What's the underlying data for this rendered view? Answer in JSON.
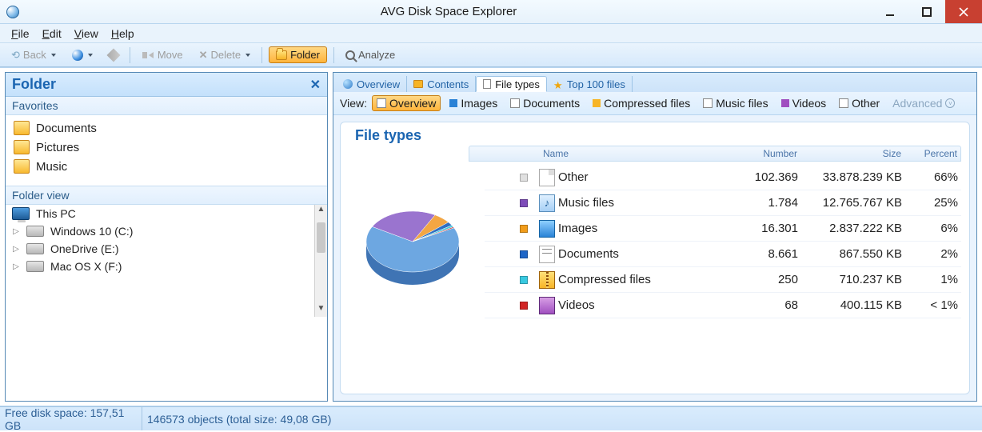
{
  "app": {
    "title": "AVG Disk Space Explorer"
  },
  "menu": {
    "file": "File",
    "edit": "Edit",
    "view": "View",
    "help": "Help"
  },
  "toolbar": {
    "back": "Back",
    "move": "Move",
    "delete": "Delete",
    "folder": "Folder",
    "analyze": "Analyze"
  },
  "sidebar": {
    "title": "Folder",
    "favorites_label": "Favorites",
    "favorites": [
      {
        "label": "Documents"
      },
      {
        "label": "Pictures"
      },
      {
        "label": "Music"
      }
    ],
    "folder_view_label": "Folder view",
    "tree": [
      {
        "label": "This PC",
        "bold": true,
        "icon": "pc"
      },
      {
        "label": "Windows 10 (C:)",
        "icon": "drive"
      },
      {
        "label": "OneDrive (E:)",
        "icon": "drive"
      },
      {
        "label": "Mac OS X (F:)",
        "icon": "drive"
      }
    ]
  },
  "tabs": [
    "Overview",
    "Contents",
    "File types",
    "Top 100 files"
  ],
  "tabs_active_index": 2,
  "viewbar": {
    "label": "View:",
    "items": [
      "Overview",
      "Images",
      "Documents",
      "Compressed files",
      "Music files",
      "Videos",
      "Other"
    ],
    "advanced_label": "Advanced"
  },
  "panel": {
    "title": "File types",
    "columns": {
      "name": "Name",
      "number": "Number",
      "size": "Size",
      "percent": "Percent"
    },
    "rows": [
      {
        "name": "Other",
        "number": "102.369",
        "size": "33.878.239 KB",
        "percent": "66%",
        "color": "#e0e0e0",
        "icon": "doc"
      },
      {
        "name": "Music files",
        "number": "1.784",
        "size": "12.765.767 KB",
        "percent": "25%",
        "color": "#7e4cb9",
        "icon": "music"
      },
      {
        "name": "Images",
        "number": "16.301",
        "size": "2.837.222 KB",
        "percent": "6%",
        "color": "#f19c1a",
        "icon": "img"
      },
      {
        "name": "Documents",
        "number": "8.661",
        "size": "867.550 KB",
        "percent": "2%",
        "color": "#1e66c7",
        "icon": "docs"
      },
      {
        "name": "Compressed files",
        "number": "250",
        "size": "710.237 KB",
        "percent": "1%",
        "color": "#38c9e0",
        "icon": "zip"
      },
      {
        "name": "Videos",
        "number": "68",
        "size": "400.115 KB",
        "percent": "< 1%",
        "color": "#d22424",
        "icon": "vid"
      }
    ]
  },
  "statusbar": {
    "free": "Free disk space: 157,51 GB",
    "objects": "146573 objects (total size: 49,08 GB)"
  },
  "chart_data": {
    "type": "pie",
    "title": "File types",
    "series": [
      {
        "name": "Other",
        "value": 66,
        "color": "#6da7e1"
      },
      {
        "name": "Music files",
        "value": 25,
        "color": "#9a74cf"
      },
      {
        "name": "Images",
        "value": 6,
        "color": "#f3a643"
      },
      {
        "name": "Documents",
        "value": 2,
        "color": "#2f6fc3"
      },
      {
        "name": "Compressed files",
        "value": 1,
        "color": "#45c8de"
      },
      {
        "name": "Videos",
        "value": 0.5,
        "color": "#d22424"
      }
    ]
  }
}
